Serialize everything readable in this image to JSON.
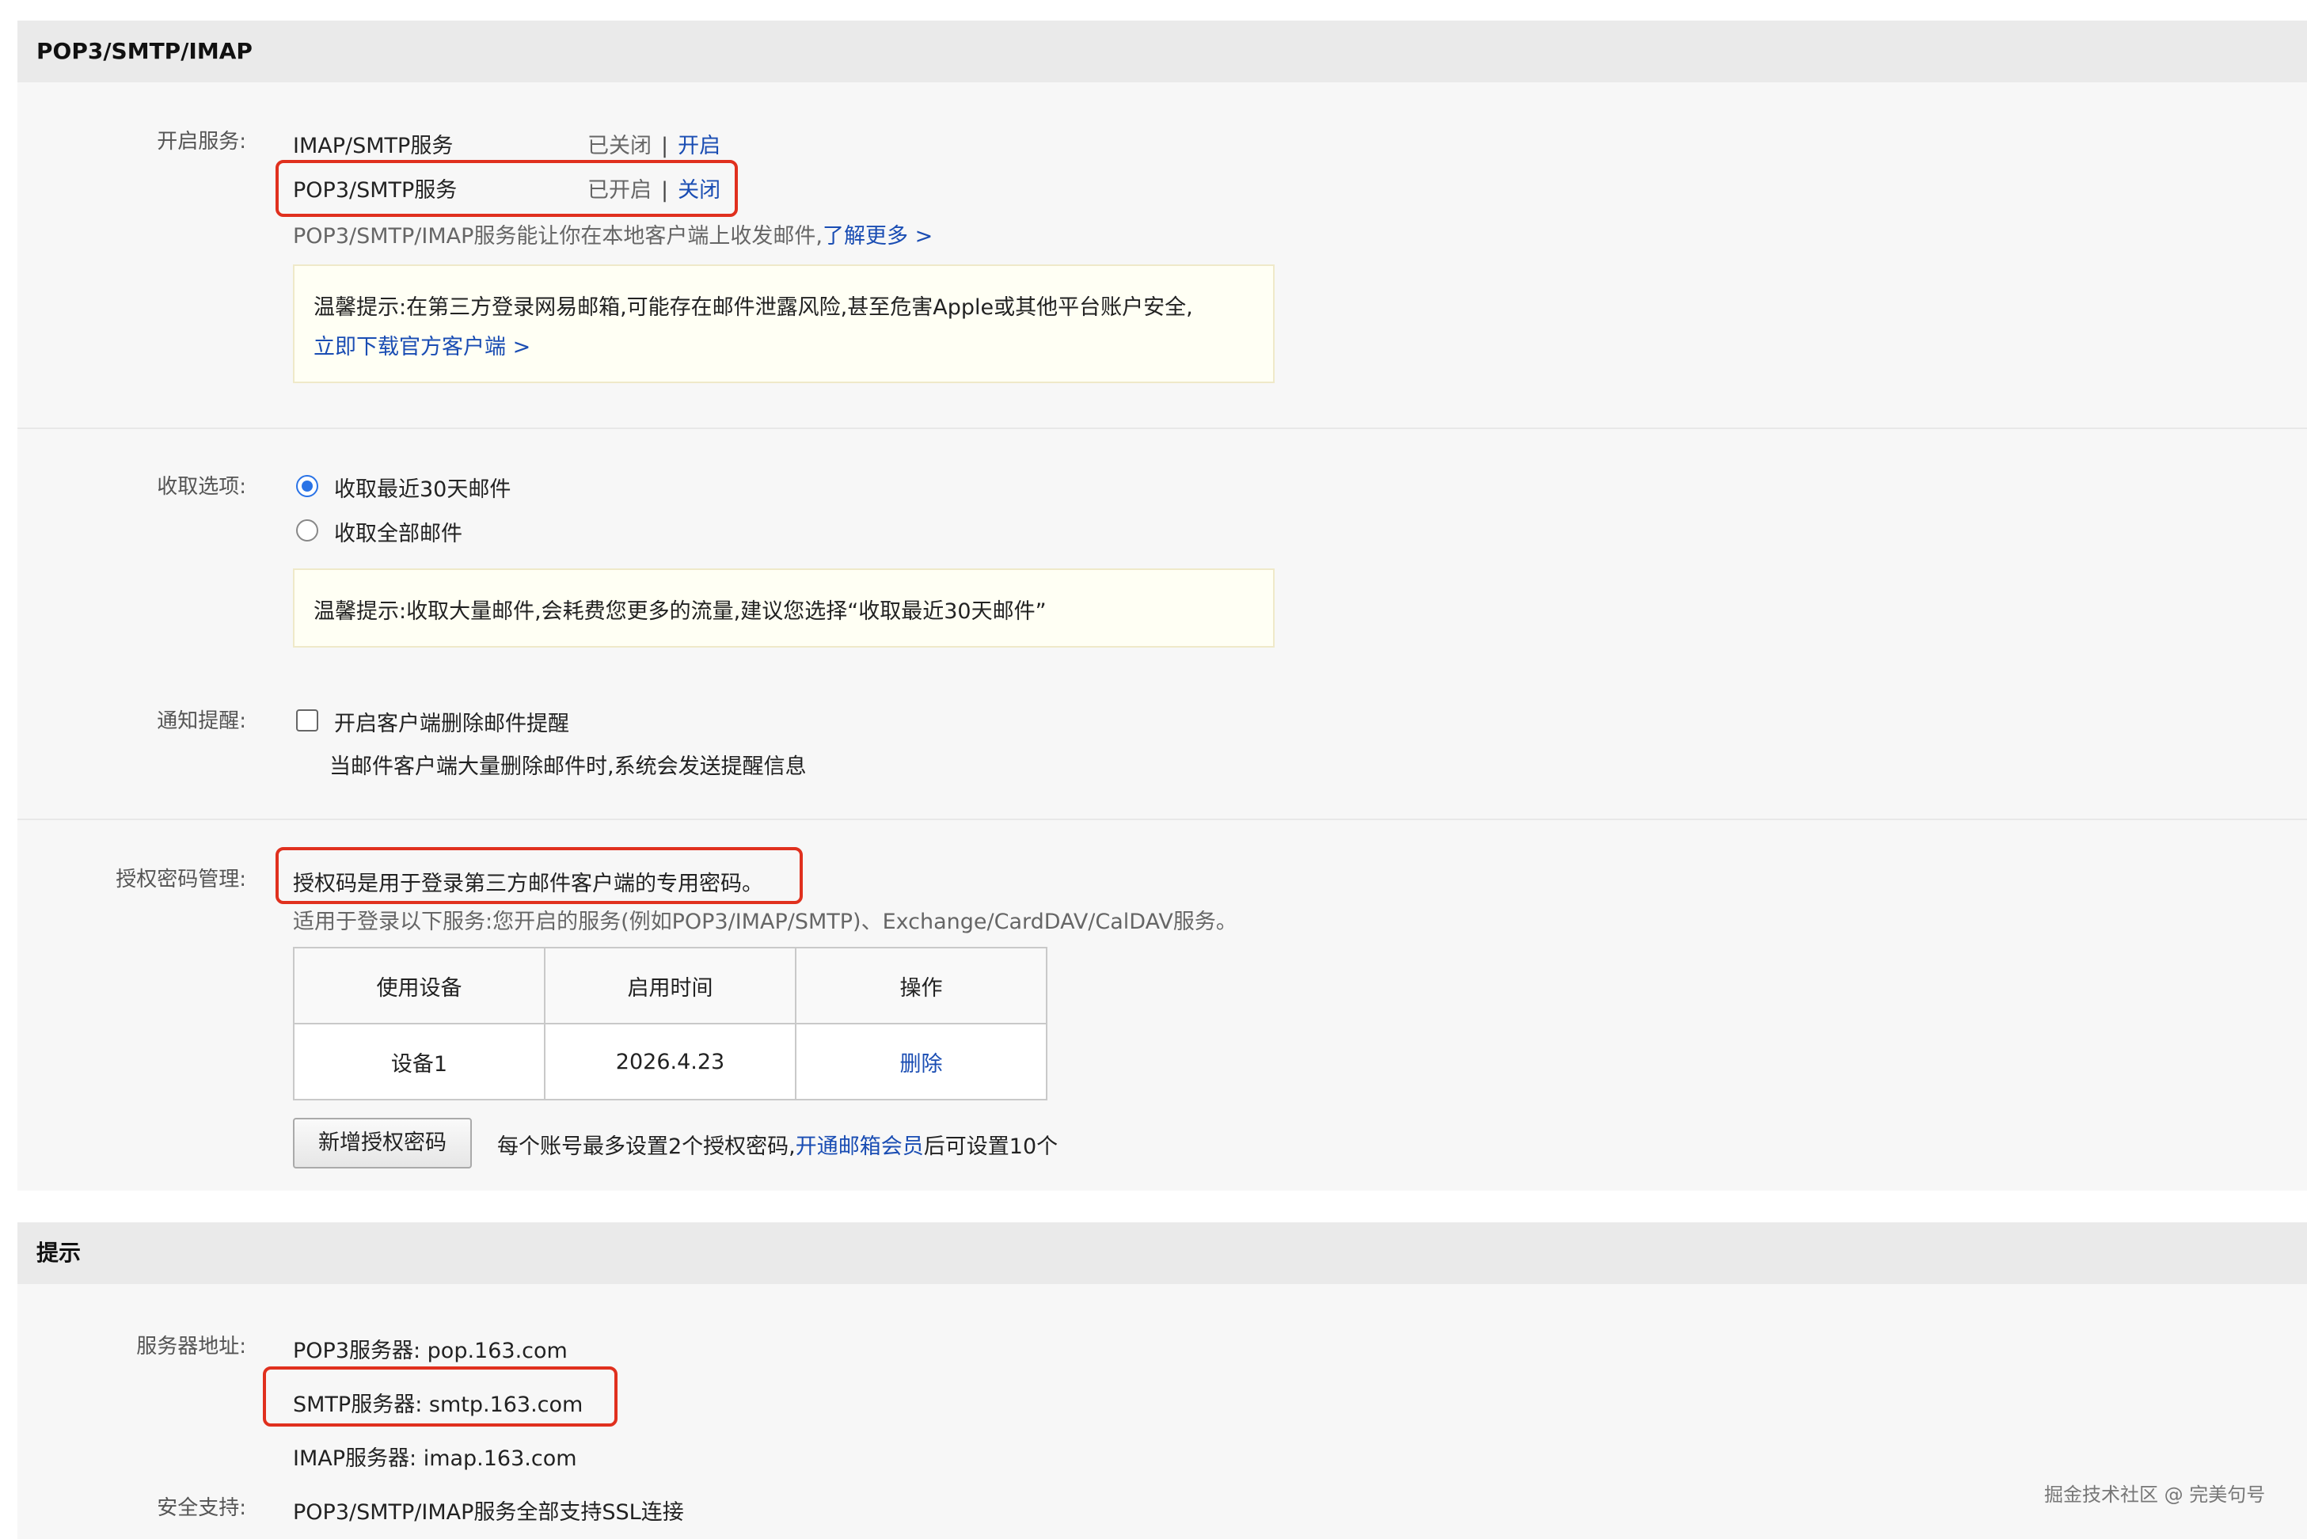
{
  "section1": {
    "title": "POP3/SMTP/IMAP",
    "service_label": "开启服务:",
    "services": [
      {
        "name": "IMAP/SMTP服务",
        "status": "已关闭",
        "action": "开启"
      },
      {
        "name": "POP3/SMTP服务",
        "status": "已开启",
        "action": "关闭"
      }
    ],
    "separator": "|",
    "service_desc": "POP3/SMTP/IMAP服务能让你在本地客户端上收发邮件,",
    "learn_more": "了解更多 >",
    "tip1_text": "温馨提示:在第三方登录网易邮箱,可能存在邮件泄露风险,甚至危害Apple或其他平台账户安全,",
    "tip1_link": "立即下载官方客户端 >",
    "fetch_label": "收取选项:",
    "fetch_options": [
      {
        "label": "收取最近30天邮件",
        "checked": true
      },
      {
        "label": "收取全部邮件",
        "checked": false
      }
    ],
    "tip2_text": "温馨提示:收取大量邮件,会耗费您更多的流量,建议您选择“收取最近30天邮件”",
    "notify_label": "通知提醒:",
    "notify_option": "开启客户端删除邮件提醒",
    "notify_desc": "当邮件客户端大量删除邮件时,系统会发送提醒信息",
    "auth_label": "授权密码管理:",
    "auth_desc": "授权码是用于登录第三方邮件客户端的专用密码。",
    "auth_desc2": "适用于登录以下服务:您开启的服务(例如POP3/IMAP/SMTP)、Exchange/CardDAV/CalDAV服务。",
    "table": {
      "headers": [
        "使用设备",
        "启用时间",
        "操作"
      ],
      "rows": [
        {
          "device": "设备1",
          "time": "2026.4.23",
          "action": "删除"
        }
      ]
    },
    "add_button": "新增授权密码",
    "limit_text_pre": "每个账号最多设置2个授权密码,",
    "limit_link": "开通邮箱会员",
    "limit_text_post": "后可设置10个"
  },
  "section2": {
    "title": "提示",
    "server_label": "服务器地址:",
    "servers": [
      "POP3服务器: pop.163.com",
      "SMTP服务器: smtp.163.com",
      "IMAP服务器: imap.163.com"
    ],
    "security_label": "安全支持:",
    "security_text": "POP3/SMTP/IMAP服务全部支持SSL连接"
  },
  "watermark": "掘金技术社区 @ 完美句号",
  "colors": {
    "highlight": "#e0301e",
    "link": "#1a4db3",
    "radio": "#2a73e6"
  }
}
